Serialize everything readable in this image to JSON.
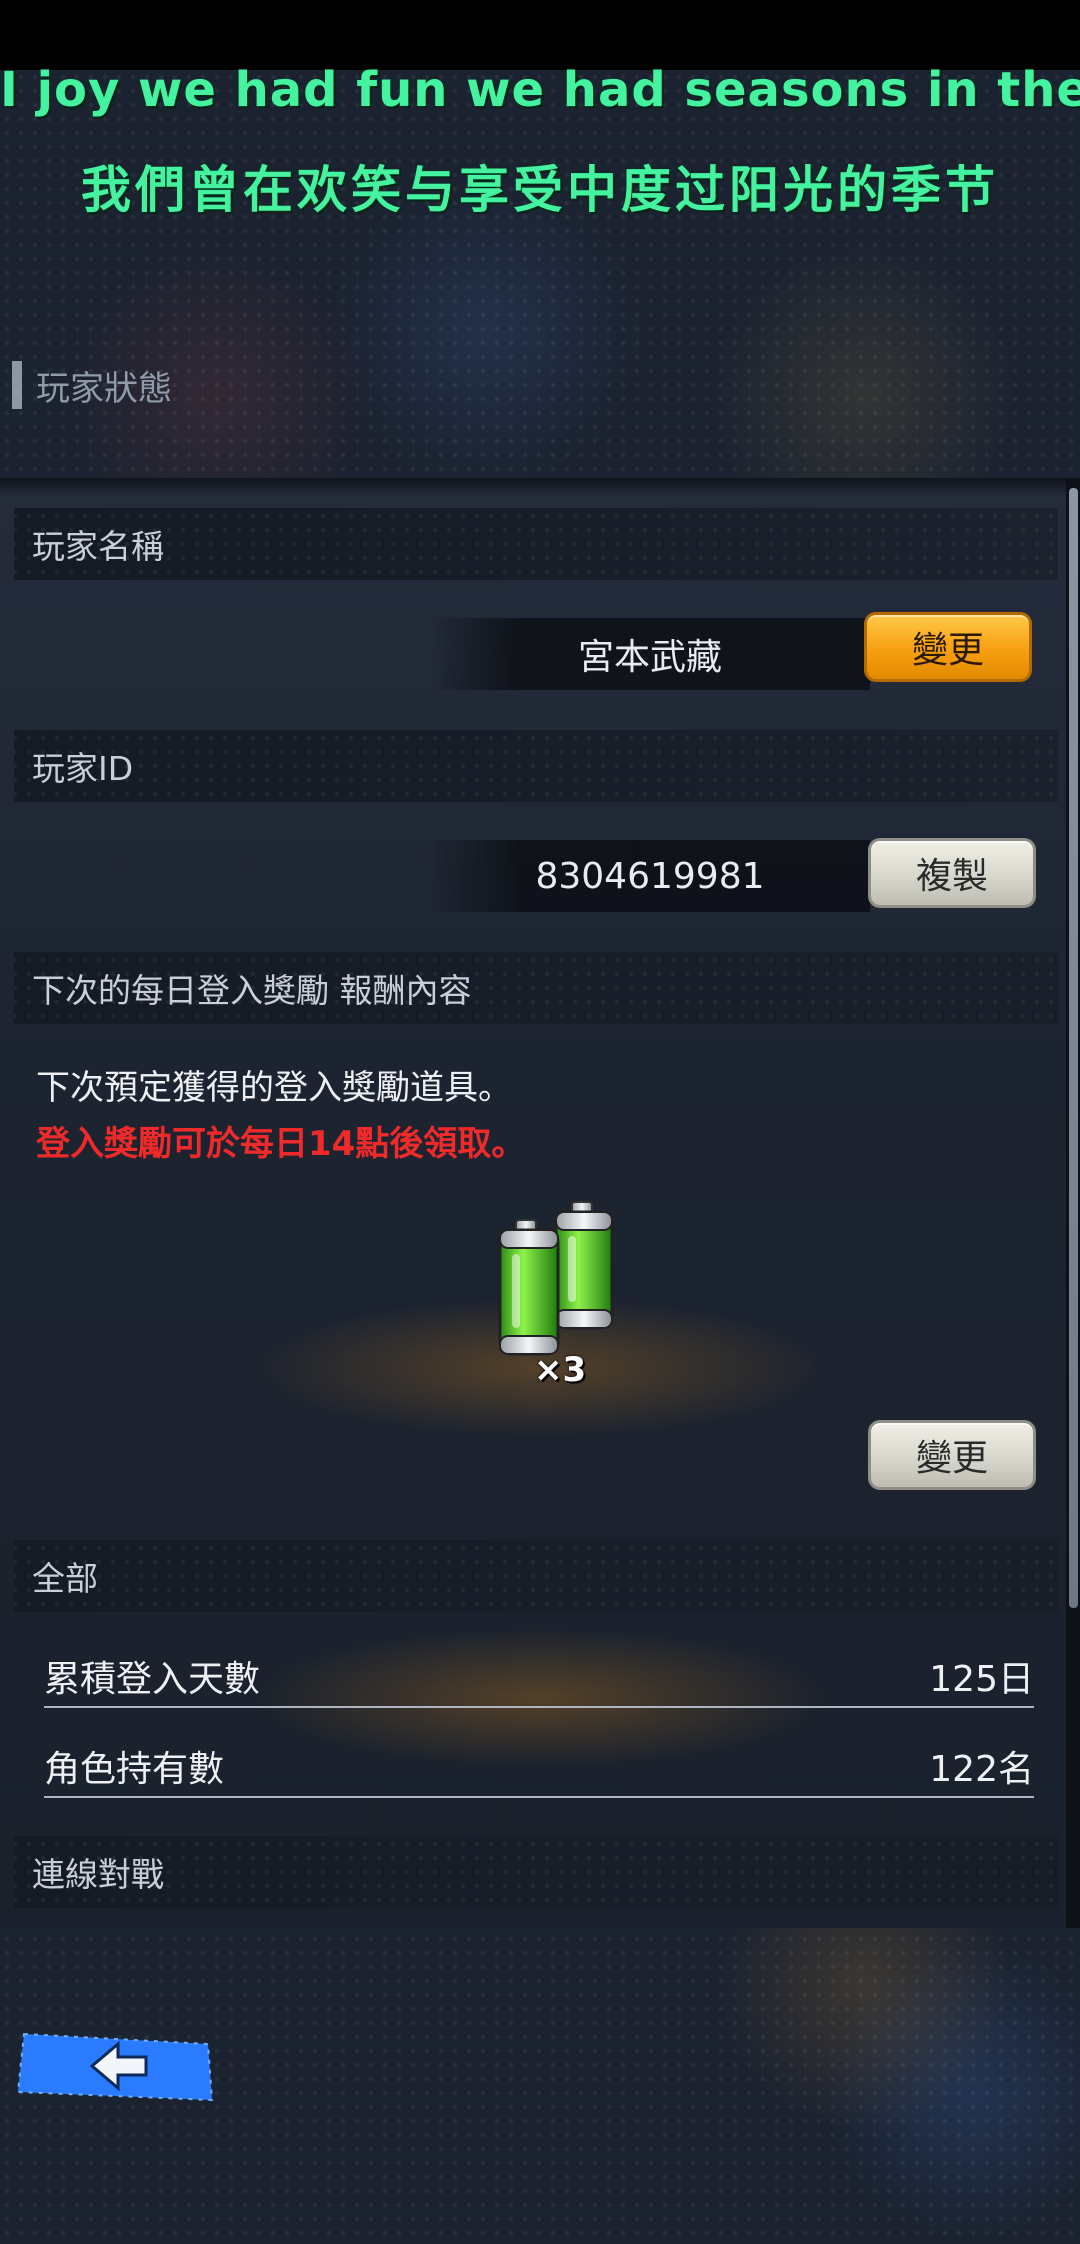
{
  "lyrics": {
    "english": "I joy we had fun we had seasons in the sun",
    "chinese": "我們曾在欢笑与享受中度过阳光的季节"
  },
  "page": {
    "title": "玩家狀態"
  },
  "player_name": {
    "section_label": "玩家名稱",
    "value": "宮本武藏",
    "change_button": "變更"
  },
  "player_id": {
    "section_label": "玩家ID",
    "value": "8304619981",
    "copy_button": "複製"
  },
  "daily_login": {
    "section_label": "下次的每日登入獎勵 報酬內容",
    "description": "下次預定獲得的登入獎勵道具。",
    "notice": "登入獎勵可於每日14點後領取。",
    "reward_icon": "battery-icon",
    "reward_quantity": "×3",
    "change_button": "變更"
  },
  "all": {
    "section_label": "全部",
    "rows": [
      {
        "label": "累積登入天數",
        "value": "125日"
      },
      {
        "label": "角色持有數",
        "value": "122名"
      }
    ]
  },
  "online_battle": {
    "section_label": "連線對戰"
  },
  "navigation": {
    "back_icon": "back-arrow-icon"
  },
  "colors": {
    "lyric": "#44f2a0",
    "notice_red": "#f02a2a",
    "primary_button": "#f6a011",
    "secondary_button": "#d8d7cd",
    "back_button": "#2a7bff"
  }
}
